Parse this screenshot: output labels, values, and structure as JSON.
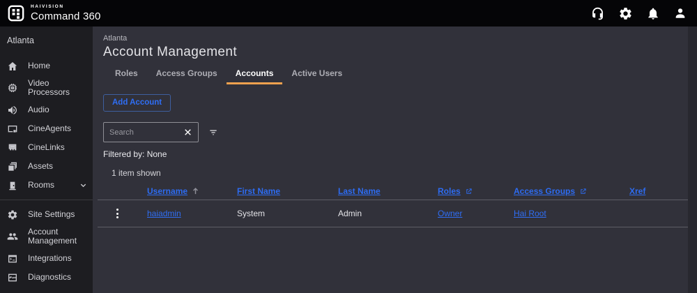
{
  "header": {
    "brand": {
      "name_top": "HAIVISION",
      "name_bottom": "Command 360"
    },
    "icons": [
      {
        "name": "support-icon"
      },
      {
        "name": "settings-icon"
      },
      {
        "name": "notifications-icon"
      },
      {
        "name": "account-icon"
      }
    ]
  },
  "sidebar": {
    "site": "Atlanta",
    "items": [
      {
        "label": "Home",
        "icon": "home-icon"
      },
      {
        "label": "Video Processors",
        "icon": "chip-icon"
      },
      {
        "label": "Audio",
        "icon": "speaker-icon"
      },
      {
        "label": "CineAgents",
        "icon": "monitor-icon"
      },
      {
        "label": "CineLinks",
        "icon": "port-icon"
      },
      {
        "label": "Assets",
        "icon": "layers-icon"
      },
      {
        "label": "Rooms",
        "icon": "door-icon",
        "expandable": true
      },
      {
        "label": "Site Settings",
        "icon": "gear-icon"
      },
      {
        "label": "Account Management",
        "icon": "people-icon"
      },
      {
        "label": "Integrations",
        "icon": "terminal-icon"
      },
      {
        "label": "Diagnostics",
        "icon": "pulse-icon"
      }
    ]
  },
  "main": {
    "breadcrumb": "Atlanta",
    "title": "Account Management",
    "tabs": [
      {
        "label": "Roles",
        "active": false
      },
      {
        "label": "Access Groups",
        "active": false
      },
      {
        "label": "Accounts",
        "active": true
      },
      {
        "label": "Active Users",
        "active": false
      }
    ],
    "add_button": "Add Account",
    "search": {
      "placeholder": "Search",
      "value": ""
    },
    "filtered_by": "Filtered by: None",
    "items_shown": "1 item shown",
    "table": {
      "columns": [
        {
          "label": "Username",
          "sort": "asc"
        },
        {
          "label": "First Name"
        },
        {
          "label": "Last Name"
        },
        {
          "label": "Roles",
          "external": true
        },
        {
          "label": "Access Groups",
          "external": true
        },
        {
          "label": "Xref"
        }
      ],
      "rows": [
        {
          "username": "haiadmin",
          "first_name": "System",
          "last_name": "Admin",
          "roles": "Owner",
          "access_groups": "Hai Root",
          "xref": ""
        }
      ]
    }
  },
  "colors": {
    "accent_orange": "#efa14e",
    "link_blue": "#2f6ef5",
    "header_bg": "#050507",
    "sidebar_bg": "#1d1d21",
    "main_bg": "#31313a"
  }
}
